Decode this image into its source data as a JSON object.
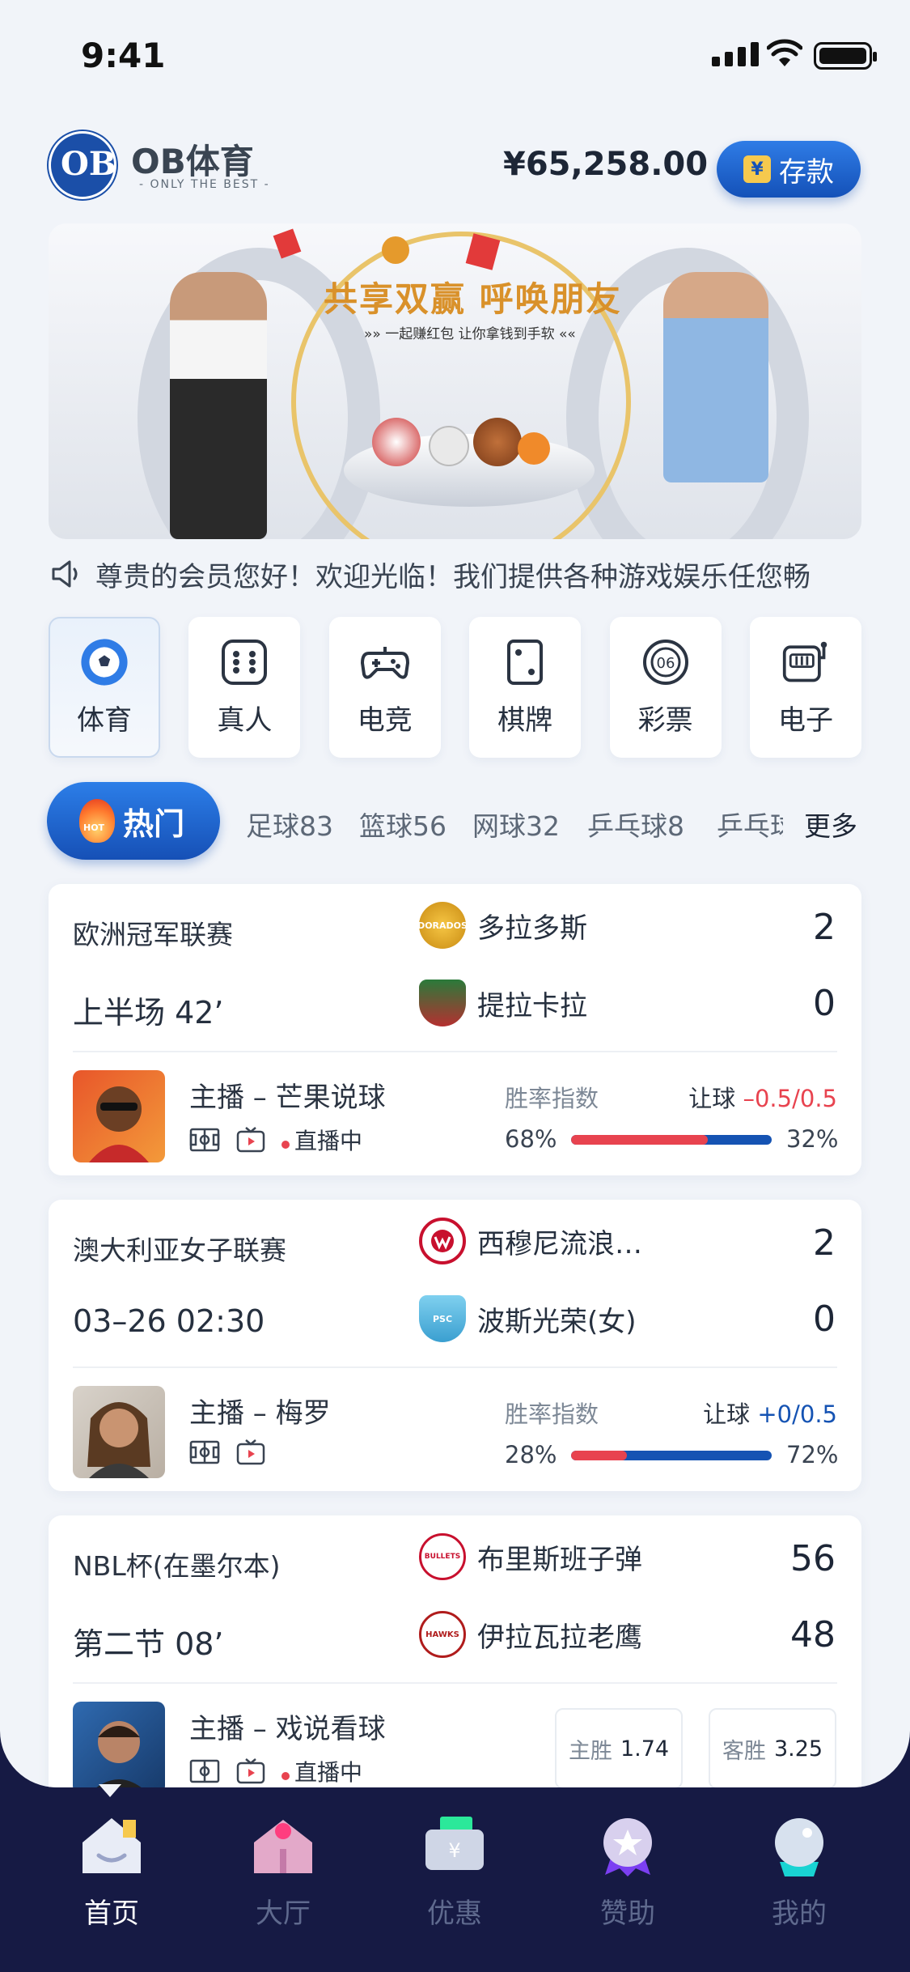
{
  "status_bar": {
    "time": "9:41"
  },
  "header": {
    "brand": "OB体育",
    "slogan": "- ONLY THE BEST -",
    "balance": "¥65,258.00",
    "deposit_label": "存款",
    "deposit_icon_glyph": "¥"
  },
  "banner": {
    "title": "共享双赢 呼唤朋友",
    "subtitle": "»» 一起赚红包 让你拿钱到手软 ««"
  },
  "notice": {
    "text": "尊贵的会员您好！欢迎光临！我们提供各种游戏娱乐任您畅"
  },
  "categories": [
    {
      "label": "体育",
      "icon": "soccer-ball-icon",
      "active": true
    },
    {
      "label": "真人",
      "icon": "dice-icon"
    },
    {
      "label": "电竞",
      "icon": "gamepad-icon"
    },
    {
      "label": "棋牌",
      "icon": "card-icon"
    },
    {
      "label": "彩票",
      "icon": "lottery-ball-icon"
    },
    {
      "label": "电子",
      "icon": "slot-machine-icon"
    }
  ],
  "sport_tabs": {
    "hot_label": "热门",
    "hot_badge": "HOT",
    "items": [
      "足球83",
      "篮球56",
      "网球32",
      "乒乓球8",
      "乒乓球"
    ],
    "more_label": "更多"
  },
  "matches": [
    {
      "league": "欧洲冠军联赛",
      "time": "上半场 42’",
      "home": {
        "name": "多拉多斯",
        "score": "2",
        "badge": "DORADOS"
      },
      "away": {
        "name": "提拉卡拉",
        "score": "0"
      },
      "host": "主播 – 芒果说球",
      "live": "直播中",
      "rate_label": "胜率指数",
      "handicap_label": "让球",
      "handicap_value": "–0.5/0.5",
      "home_pct": "68%",
      "away_pct": "32%",
      "home_share": 0.68
    },
    {
      "league": "澳大利亚女子联赛",
      "time": "03–26 02:30",
      "home": {
        "name": "西穆尼流浪…",
        "score": "2"
      },
      "away": {
        "name": "波斯光荣(女)",
        "score": "0",
        "badge": "PSC"
      },
      "host": "主播 – 梅罗",
      "rate_label": "胜率指数",
      "handicap_label": "让球",
      "handicap_value": "+0/0.5",
      "home_pct": "28%",
      "away_pct": "72%",
      "home_share": 0.28
    },
    {
      "league": "NBL杯(在墨尔本)",
      "time": "第二节 08’",
      "home": {
        "name": "布里斯班子弹",
        "score": "56",
        "badge": "BULLETS"
      },
      "away": {
        "name": "伊拉瓦拉老鹰",
        "score": "48",
        "badge": "HAWKS"
      },
      "host": "主播 – 戏说看球",
      "live": "直播中",
      "odds_home_label": "主胜",
      "odds_home": "1.74",
      "odds_away_label": "客胜",
      "odds_away": "3.25"
    }
  ],
  "nav": [
    {
      "label": "首页",
      "icon": "home-icon",
      "active": true
    },
    {
      "label": "大厅",
      "icon": "lobby-icon"
    },
    {
      "label": "优惠",
      "icon": "coupon-icon"
    },
    {
      "label": "赞助",
      "icon": "sponsor-medal-icon"
    },
    {
      "label": "我的",
      "icon": "profile-icon"
    }
  ],
  "colors": {
    "brand_blue": "#1451b8",
    "accent_red": "#e8434f",
    "nav_bg": "#161a44"
  }
}
